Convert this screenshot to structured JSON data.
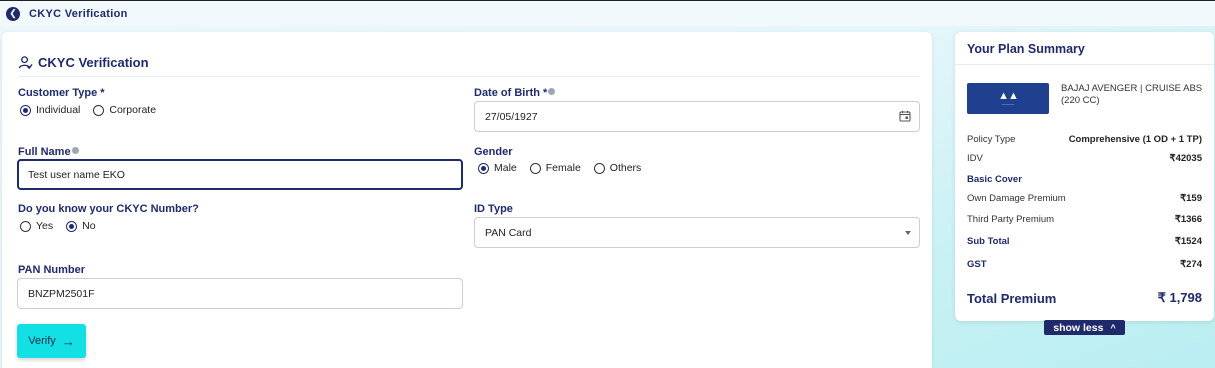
{
  "topbar": {
    "title": "CKYC Verification"
  },
  "form": {
    "section_title": "CKYC Verification",
    "customer_type": {
      "label": "Customer Type *",
      "options": [
        "Individual",
        "Corporate"
      ],
      "selected": "Individual"
    },
    "dob": {
      "label": "Date of Birth *",
      "value": "27/05/1927"
    },
    "full_name": {
      "label": "Full Name",
      "value": "Test user name EKO"
    },
    "gender": {
      "label": "Gender",
      "options": [
        "Male",
        "Female",
        "Others"
      ],
      "selected": "Male"
    },
    "ckyc_known": {
      "label": "Do you know your CKYC Number?",
      "options": [
        "Yes",
        "No"
      ],
      "selected": "No"
    },
    "id_type": {
      "label": "ID Type",
      "value": "PAN Card"
    },
    "pan": {
      "label": "PAN Number",
      "value": "BNZPM2501F"
    },
    "verify_label": "Verify"
  },
  "summary": {
    "title": "Your Plan Summary",
    "vehicle": "BAJAJ AVENGER | CRUISE ABS (220 CC)",
    "policy_type": {
      "label": "Policy Type",
      "value": "Comprehensive (1 OD + 1 TP)"
    },
    "idv": {
      "label": "IDV",
      "value": "₹42035"
    },
    "basic_cover": "Basic Cover",
    "own_damage": {
      "label": "Own Damage Premium",
      "value": "₹159"
    },
    "third_party": {
      "label": "Third Party Premium",
      "value": "₹1366"
    },
    "sub_total": {
      "label": "Sub Total",
      "value": "₹1524"
    },
    "gst": {
      "label": "GST",
      "value": "₹274"
    },
    "total": {
      "label": "Total Premium",
      "value": "₹ 1,798"
    },
    "show_less": "show less"
  },
  "colors": {
    "primary": "#1f2a6b",
    "accent": "#13e0e4"
  }
}
